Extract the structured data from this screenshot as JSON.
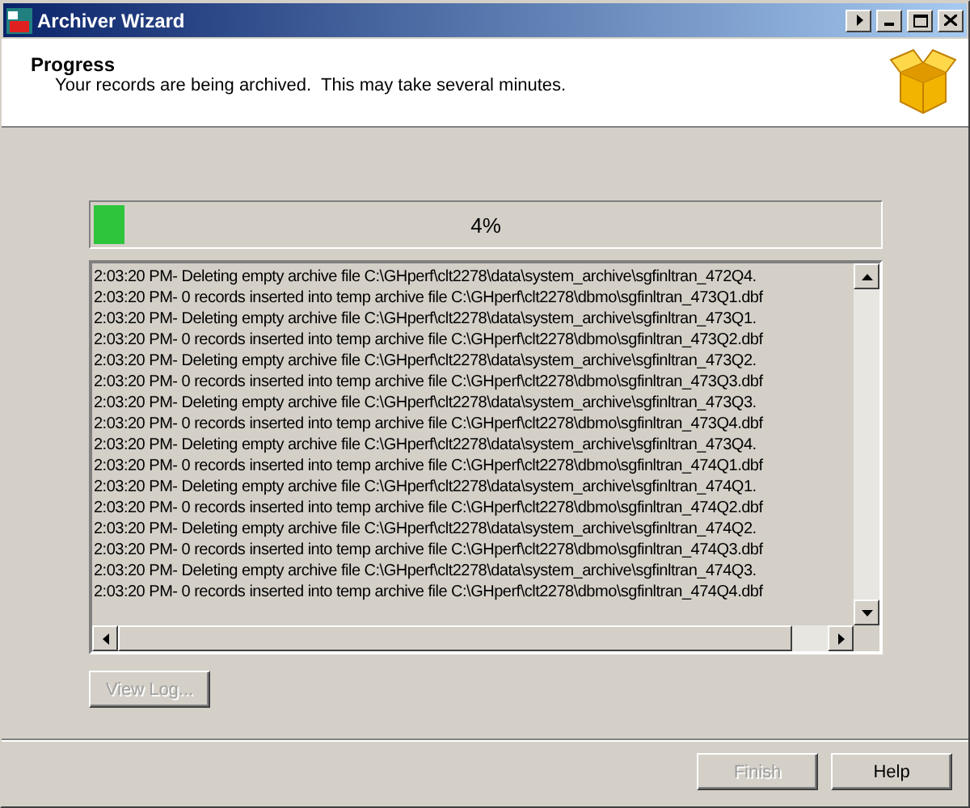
{
  "window": {
    "title": "Archiver Wizard"
  },
  "header": {
    "title": "Progress",
    "subtitle": "Your records are being archived.  This may take several minutes."
  },
  "progress": {
    "level": 0.04,
    "label": "4%"
  },
  "log": {
    "lines": [
      "2:03:20 PM- Deleting empty archive file C:\\GHperf\\clt2278\\data\\system_archive\\sgfinltran_472Q4.",
      "2:03:20 PM- 0 records inserted into temp archive file C:\\GHperf\\clt2278\\dbmo\\sgfinltran_473Q1.dbf",
      "2:03:20 PM- Deleting empty archive file C:\\GHperf\\clt2278\\data\\system_archive\\sgfinltran_473Q1.",
      "2:03:20 PM- 0 records inserted into temp archive file C:\\GHperf\\clt2278\\dbmo\\sgfinltran_473Q2.dbf",
      "2:03:20 PM- Deleting empty archive file C:\\GHperf\\clt2278\\data\\system_archive\\sgfinltran_473Q2.",
      "2:03:20 PM- 0 records inserted into temp archive file C:\\GHperf\\clt2278\\dbmo\\sgfinltran_473Q3.dbf",
      "2:03:20 PM- Deleting empty archive file C:\\GHperf\\clt2278\\data\\system_archive\\sgfinltran_473Q3.",
      "2:03:20 PM- 0 records inserted into temp archive file C:\\GHperf\\clt2278\\dbmo\\sgfinltran_473Q4.dbf",
      "2:03:20 PM- Deleting empty archive file C:\\GHperf\\clt2278\\data\\system_archive\\sgfinltran_473Q4.",
      "2:03:20 PM- 0 records inserted into temp archive file C:\\GHperf\\clt2278\\dbmo\\sgfinltran_474Q1.dbf",
      "2:03:20 PM- Deleting empty archive file C:\\GHperf\\clt2278\\data\\system_archive\\sgfinltran_474Q1.",
      "2:03:20 PM- 0 records inserted into temp archive file C:\\GHperf\\clt2278\\dbmo\\sgfinltran_474Q2.dbf",
      "2:03:20 PM- Deleting empty archive file C:\\GHperf\\clt2278\\data\\system_archive\\sgfinltran_474Q2.",
      "2:03:20 PM- 0 records inserted into temp archive file C:\\GHperf\\clt2278\\dbmo\\sgfinltran_474Q3.dbf",
      "2:03:20 PM- Deleting empty archive file C:\\GHperf\\clt2278\\data\\system_archive\\sgfinltran_474Q3.",
      "2:03:20 PM- 0 records inserted into temp archive file C:\\GHperf\\clt2278\\dbmo\\sgfinltran_474Q4.dbf"
    ]
  },
  "buttons": [
    {
      "kind": "side",
      "label": "View Log...",
      "disabled": true
    },
    {
      "kind": "footer",
      "label": "Finish",
      "disabled": true
    },
    {
      "kind": "footer",
      "label": "Help",
      "disabled": false
    }
  ]
}
